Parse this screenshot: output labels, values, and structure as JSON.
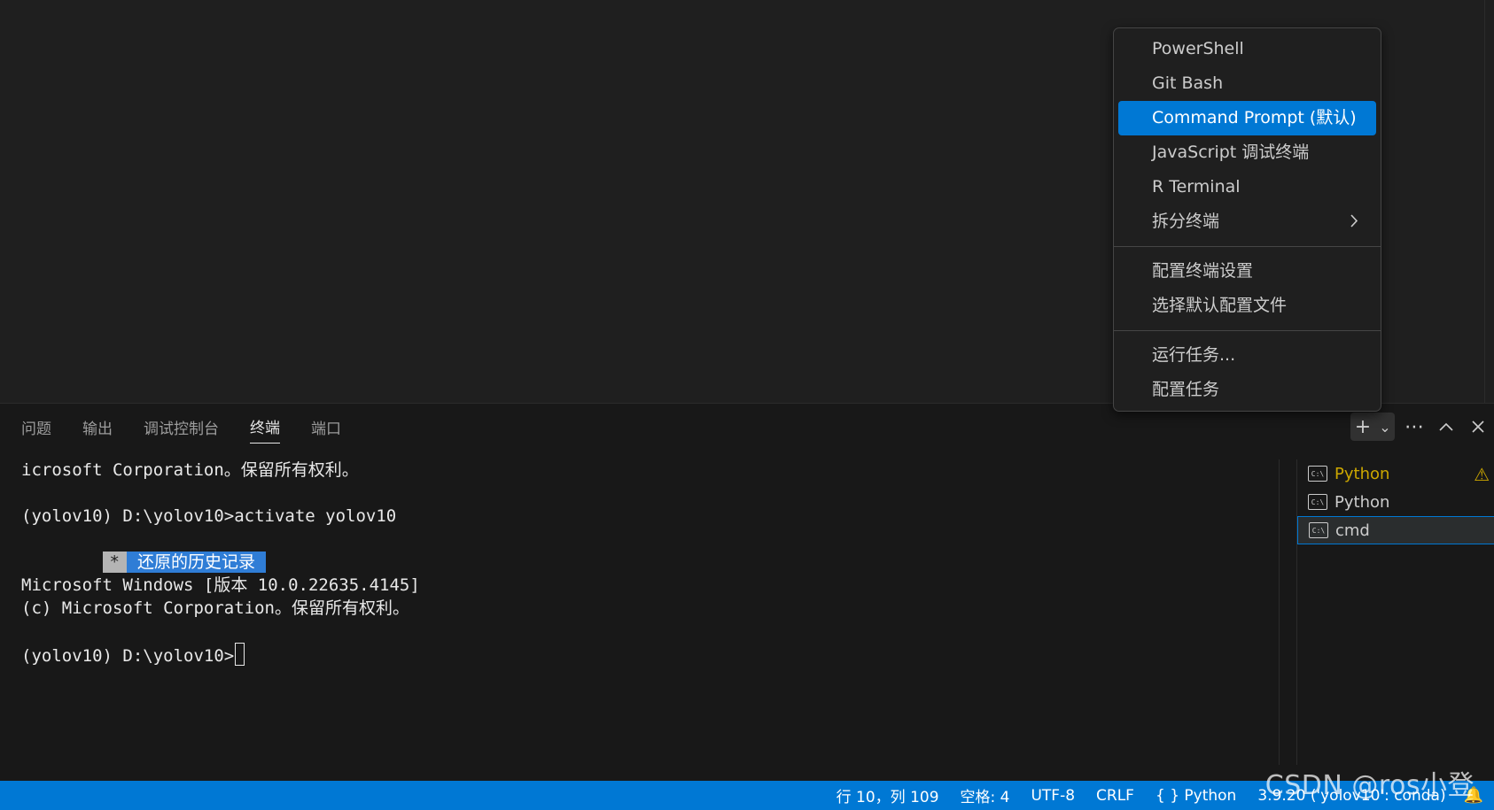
{
  "panel": {
    "tabs": [
      {
        "label": "问题"
      },
      {
        "label": "输出"
      },
      {
        "label": "调试控制台"
      },
      {
        "label": "终端"
      },
      {
        "label": "端口"
      }
    ],
    "active_tab": "终端",
    "actions": {
      "new_terminal_icon": "plus-icon",
      "dropdown_icon": "chevron-down-icon",
      "more_icon": "ellipsis-icon",
      "maximize_icon": "chevron-up-icon",
      "close_icon": "close-icon"
    }
  },
  "terminal": {
    "lines": [
      "icrosoft Corporation。保留所有权利。",
      "",
      "(yolov10) D:\\yolov10>activate yolov10"
    ],
    "restore": {
      "star": "*",
      "text": "还原的历史记录"
    },
    "lines_after": [
      "",
      "Microsoft Windows [版本 10.0.22635.4145]",
      "(c) Microsoft Corporation。保留所有权利。",
      ""
    ],
    "prompt": "(yolov10) D:\\yolov10>"
  },
  "terminal_list": [
    {
      "name": "Python",
      "warning": true
    },
    {
      "name": "Python",
      "warning": false
    },
    {
      "name": "cmd",
      "warning": false,
      "selected": true
    }
  ],
  "menu": {
    "group1": [
      {
        "label": "PowerShell"
      },
      {
        "label": "Git Bash"
      },
      {
        "label": "Command Prompt (默认)",
        "highlighted": true
      },
      {
        "label": "JavaScript 调试终端"
      },
      {
        "label": "R Terminal"
      },
      {
        "label": "拆分终端",
        "submenu": true
      }
    ],
    "group2": [
      {
        "label": "配置终端设置"
      },
      {
        "label": "选择默认配置文件"
      }
    ],
    "group3": [
      {
        "label": "运行任务..."
      },
      {
        "label": "配置任务"
      }
    ]
  },
  "status_bar": {
    "position": "行 10，列 109",
    "spaces": "空格: 4",
    "encoding": "UTF-8",
    "eol": "CRLF",
    "language": "{ } Python",
    "interpreter": "3.9.20 ('yolov10': conda)",
    "color": "#0078d4"
  },
  "watermark": "CSDN @ros小登"
}
